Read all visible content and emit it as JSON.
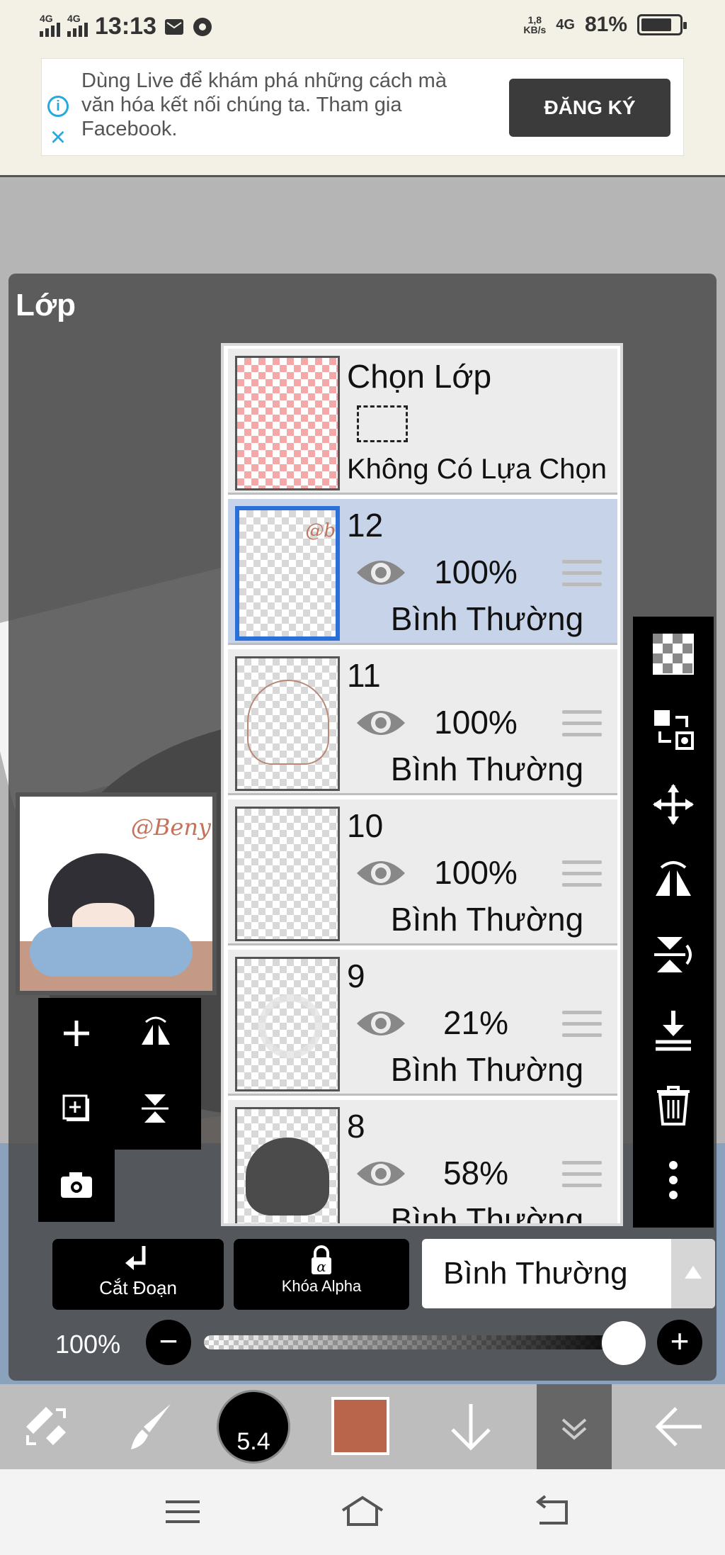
{
  "status_bar": {
    "net1": "4G",
    "net2": "4G",
    "time": "13:13",
    "speed_value": "1,8",
    "speed_unit": "KB/s",
    "net3": "4G",
    "battery": "81%",
    "battery_level": 0.81
  },
  "ad": {
    "text": "Dùng Live để khám phá những cách mà văn hóa kết nối chúng ta. Tham gia Facebook.",
    "button": "ĐĂNG KÝ"
  },
  "panel": {
    "title": "Lớp",
    "selection_layer": {
      "title": "Chọn Lớp",
      "status": "Không Có Lựa Chọn"
    },
    "layers": [
      {
        "number": "12",
        "opacity": "100%",
        "blend": "Bình Thường",
        "selected": true,
        "mark": "@b"
      },
      {
        "number": "11",
        "opacity": "100%",
        "blend": "Bình Thường",
        "selected": false
      },
      {
        "number": "10",
        "opacity": "100%",
        "blend": "Bình Thường",
        "selected": false
      },
      {
        "number": "9",
        "opacity": "21%",
        "blend": "Bình Thường",
        "selected": false
      },
      {
        "number": "8",
        "opacity": "58%",
        "blend": "Bình Thường",
        "selected": false
      }
    ],
    "preview_signature": "@Beny",
    "clip_label": "Cắt Đoạn",
    "alpha_lock_label": "Khóa Alpha",
    "blend_mode": "Bình Thường",
    "opacity_label": "100%",
    "opacity_value": 1.0,
    "minus": "−",
    "plus": "+"
  },
  "toolbar": {
    "brush_size": "5.4",
    "color": "#b9654b"
  },
  "icons": {
    "ad": [
      "info-icon",
      "close-icon"
    ],
    "left_tools": [
      "add-layer-icon",
      "flip-horizontal-icon",
      "duplicate-layer-icon",
      "flip-vertical-icon",
      "camera-icon"
    ],
    "right_tools": [
      "transparency-icon",
      "layer-transfer-icon",
      "move-icon",
      "flip-horizontal-icon",
      "flip-vertical-icon",
      "merge-down-icon",
      "trash-icon",
      "more-icon"
    ],
    "bottom": [
      "tool-swap-icon",
      "brush-icon",
      "arrow-down-icon",
      "expand-icon",
      "back-arrow-icon"
    ],
    "system": [
      "menu-icon",
      "home-icon",
      "back-icon"
    ]
  }
}
